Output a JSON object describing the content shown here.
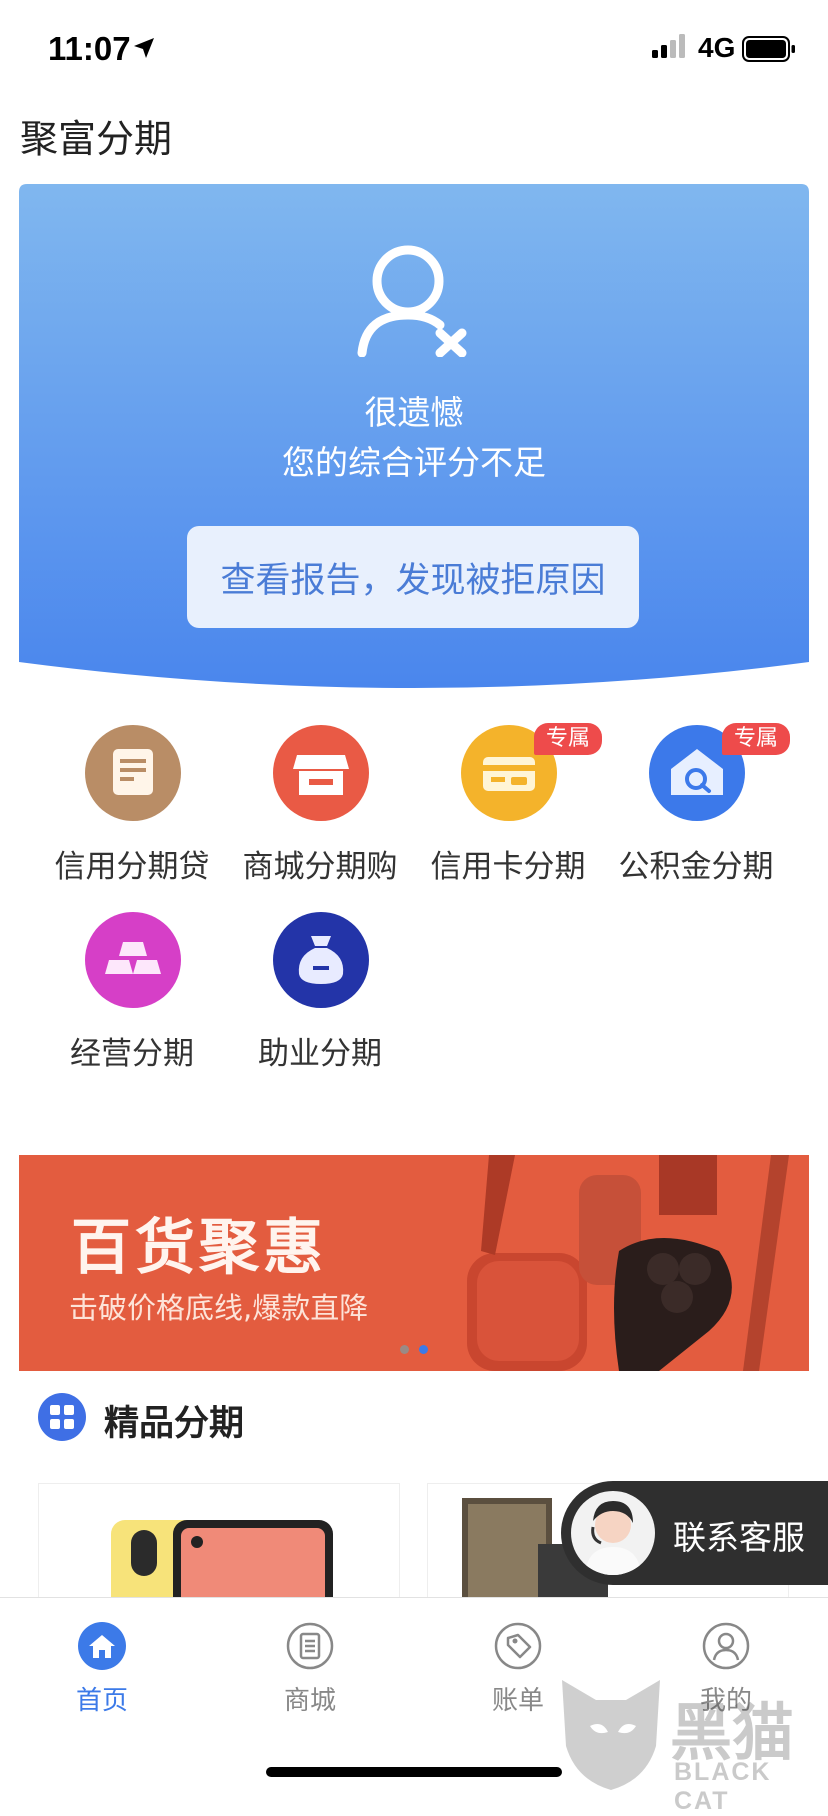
{
  "status_bar": {
    "time": "11:07",
    "network": "4G"
  },
  "app": {
    "title": "聚富分期"
  },
  "hero": {
    "line1": "很遗憾",
    "line2": "您的综合评分不足",
    "button_label": "查看报告，发现被拒原因",
    "icon": "user-rejected-icon"
  },
  "services": [
    {
      "label": "信用分期贷",
      "icon": "document-icon",
      "color": "#b98d66",
      "tag": ""
    },
    {
      "label": "商城分期购",
      "icon": "store-icon",
      "color": "#e95a45",
      "tag": ""
    },
    {
      "label": "信用卡分期",
      "icon": "credit-card-icon",
      "color": "#f4b32b",
      "tag": "专属"
    },
    {
      "label": "公积金分期",
      "icon": "house-search-icon",
      "color": "#3c79ea",
      "tag": "专属"
    },
    {
      "label": "经营分期",
      "icon": "gold-bars-icon",
      "color": "#d63fc7",
      "tag": ""
    },
    {
      "label": "助业分期",
      "icon": "money-bag-icon",
      "color": "#2334a8",
      "tag": ""
    }
  ],
  "banner": {
    "headline": "百货聚惠",
    "subtitle": "击破价格底线,爆款直降",
    "active_slide": 2,
    "slide_count": 2
  },
  "section": {
    "title": "精品分期"
  },
  "customer_service": {
    "label": "联系客服"
  },
  "tabbar": {
    "active": 0,
    "tabs": [
      {
        "label": "首页",
        "icon": "home-icon"
      },
      {
        "label": "商城",
        "icon": "mall-icon"
      },
      {
        "label": "账单",
        "icon": "tag-icon"
      },
      {
        "label": "我的",
        "icon": "profile-icon"
      }
    ]
  },
  "watermark": {
    "text": "黑猫",
    "sub": "BLACK CAT"
  },
  "colors": {
    "accent": "#3c7ae8",
    "hero_top": "#7fb6ee",
    "hero_bottom": "#4b86ed",
    "banner": "#e35c3f"
  }
}
